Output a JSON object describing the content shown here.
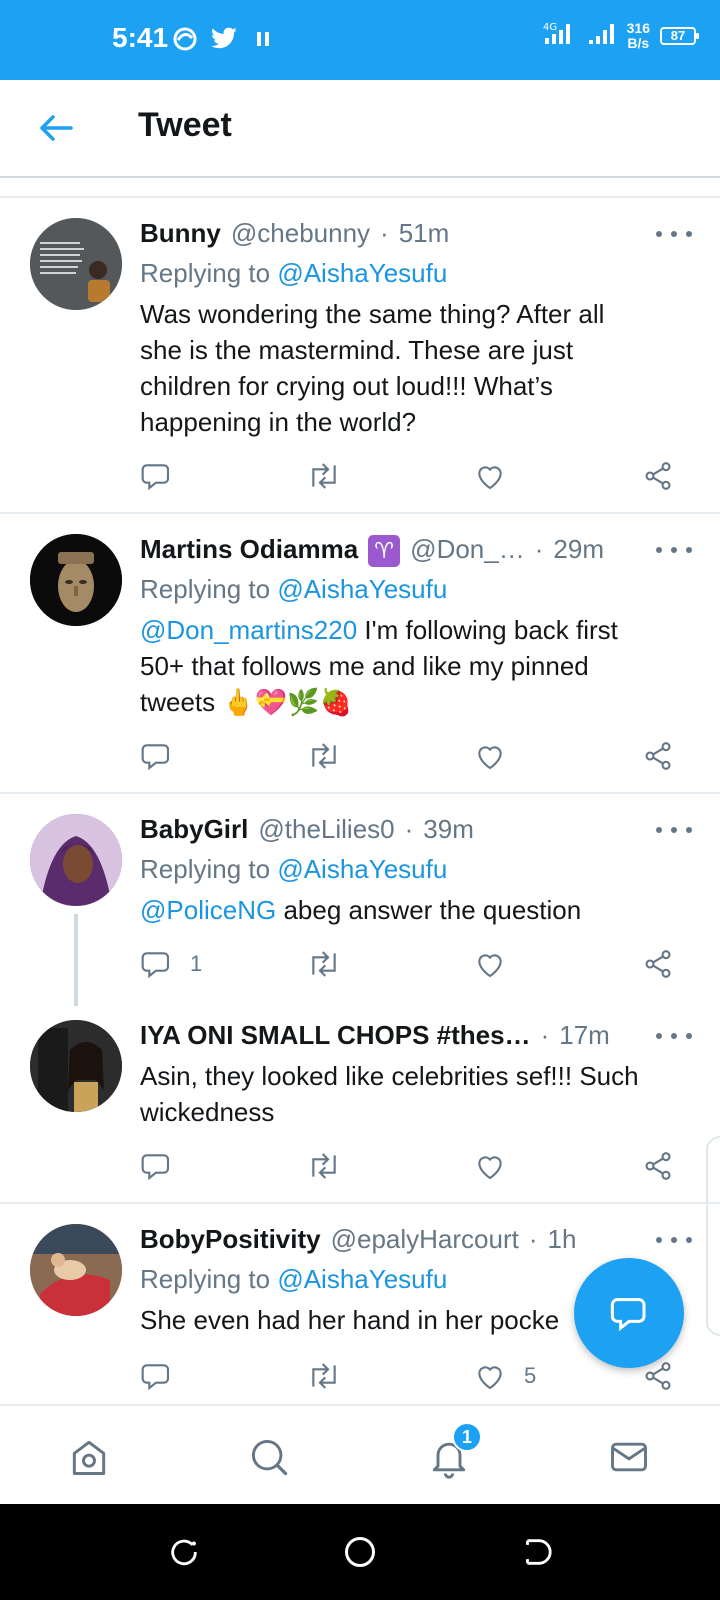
{
  "status_bar": {
    "time": "5:41",
    "network_speed_value": "316",
    "network_speed_unit": "B/s",
    "battery": "87",
    "network_type": "4G"
  },
  "header": {
    "title": "Tweet"
  },
  "tweets": [
    {
      "name": "Bunny",
      "handle": "@chebunny",
      "time": "51m",
      "replying_prefix": "Replying to",
      "replying_to": "@AishaYesufu",
      "text_lines": [
        "Was wondering the same thing? After all",
        "she is the mastermind. These are just",
        "children for crying out loud!!! What’s",
        "happening in the world?"
      ],
      "reply_count": "",
      "like_count": ""
    },
    {
      "name": "Martins Odiamma",
      "name_emoji": "♈",
      "handle": "@Don_…",
      "time": "29m",
      "replying_prefix": "Replying to",
      "replying_to": "@AishaYesufu",
      "mention": "@Don_martins220",
      "text_lines": [
        " I'm following back first",
        "50+ that follows me and like my pinned",
        "tweets "
      ],
      "emojis": "🖕💝🌿🍓",
      "reply_count": "",
      "like_count": ""
    },
    {
      "name": "BabyGirl",
      "handle": "@theLilies0",
      "time": "39m",
      "replying_prefix": "Replying to",
      "replying_to": "@AishaYesufu",
      "mention": "@PoliceNG",
      "text_lines": [
        " abeg answer the question"
      ],
      "reply_count": "1",
      "like_count": ""
    },
    {
      "name": "IYA ONI SMALL CHOPS #thes…",
      "handle": "",
      "time": "17m",
      "text_lines": [
        "Asin, they looked like celebrities sef!!! Such",
        "wickedness"
      ],
      "reply_count": "",
      "like_count": ""
    },
    {
      "name": "BobyPositivity",
      "handle": "@epalyHarcourt",
      "time": "1h",
      "replying_prefix": "Replying to",
      "replying_to": "@AishaYesufu",
      "text_lines": [
        "She even had her hand in her pocke"
      ],
      "reply_count": "",
      "like_count": "5"
    }
  ],
  "bottom_nav": {
    "notification_badge": "1"
  },
  "colors": {
    "brand": "#1da1f2",
    "link": "#1b95e0",
    "muted": "#657786"
  }
}
